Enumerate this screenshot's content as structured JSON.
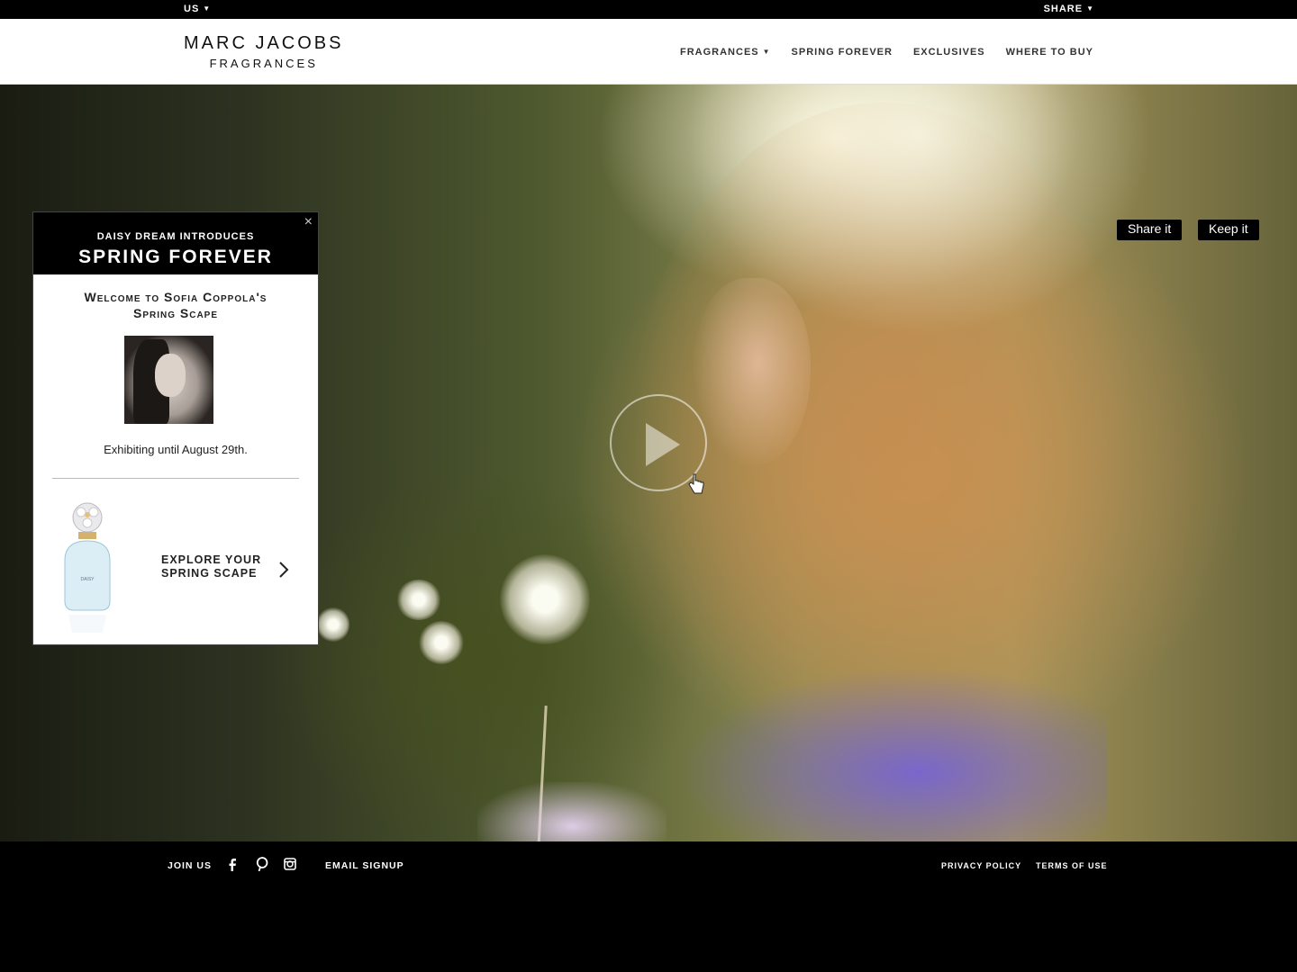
{
  "topbar": {
    "region": "US",
    "share": "SHARE",
    "caret": "▼"
  },
  "brand": {
    "line1": "MARC JACOBS",
    "line2": "FRAGRANCES"
  },
  "nav": {
    "items": [
      {
        "label": "FRAGRANCES",
        "has_dropdown": true
      },
      {
        "label": "SPRING FOREVER"
      },
      {
        "label": "EXCLUSIVES"
      },
      {
        "label": "WHERE TO BUY"
      }
    ]
  },
  "hero": {
    "share_button": "Share it",
    "keep_button": "Keep it",
    "play_icon": "play-icon"
  },
  "popup": {
    "intro": "DAISY DREAM INTRODUCES",
    "title": "SPRING FOREVER",
    "close_icon": "×",
    "welcome_line1": "Welcome to Sofia Coppola's",
    "welcome_line2": "Spring Scape",
    "exhibiting": "Exhibiting until August 29th.",
    "product_label": "DAISY",
    "explore_line1": "EXPLORE YOUR",
    "explore_line2": "SPRING SCAPE"
  },
  "footer": {
    "join": "JOIN US",
    "email_signup": "EMAIL SIGNUP",
    "privacy": "PRIVACY POLICY",
    "terms": "TERMS OF USE",
    "social": [
      "facebook-icon",
      "pinterest-icon",
      "instagram-icon"
    ]
  },
  "colors": {
    "bar": "#000000",
    "header": "#ffffff",
    "accent_dress": "#6e5fc4"
  }
}
